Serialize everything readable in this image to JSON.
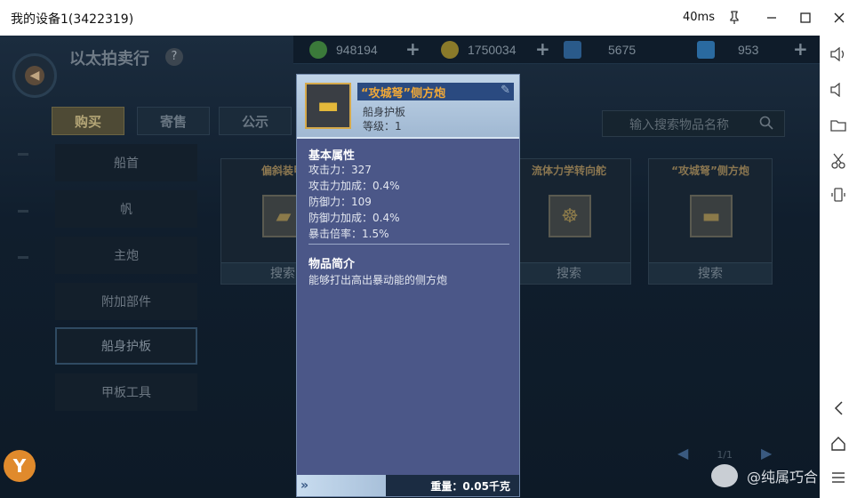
{
  "window": {
    "title": "我的设备1(3422319)",
    "latency": "40ms",
    "pin_icon": "pin-icon",
    "minimize_icon": "minimize-icon",
    "maximize_icon": "maximize-icon",
    "close_icon": "close-icon"
  },
  "sidebar": {
    "items": [
      {
        "name": "volume-up-icon",
        "glyph": "🔊"
      },
      {
        "name": "volume-down-icon",
        "glyph": "🔉"
      },
      {
        "name": "folder-icon",
        "glyph": "🗀"
      },
      {
        "name": "scissors-icon",
        "glyph": "✂"
      },
      {
        "name": "rotate-icon",
        "glyph": "⟲"
      },
      {
        "name": "back-icon",
        "glyph": "‹"
      },
      {
        "name": "home-icon",
        "glyph": "⌂"
      },
      {
        "name": "menu-icon",
        "glyph": "☰"
      }
    ]
  },
  "game": {
    "page_title": "以太拍卖行",
    "help_label": "?",
    "resources": [
      {
        "value": "948194",
        "color": "#3b7a3a"
      },
      {
        "value": "1750034",
        "color": "#8a7a2a"
      },
      {
        "value": "5675",
        "color": "#2a5a8a"
      },
      {
        "value": "953",
        "color": "#2a6aa0"
      }
    ],
    "plus": "+",
    "tabs": [
      "购买",
      "寄售",
      "公示"
    ],
    "search_placeholder": "输入搜索物品名称",
    "categories": [
      "船首",
      "帆",
      "主炮",
      "附加部件",
      "船身护板",
      "甲板工具"
    ],
    "active_category_index": 4,
    "cards": [
      {
        "title": "偏斜装甲",
        "button": "搜索"
      },
      {
        "title": "流体力学转向舵",
        "button": "搜索"
      },
      {
        "title": "“攻城弩”侧方炮",
        "button": "搜索"
      }
    ],
    "pager": "1/1"
  },
  "popup": {
    "item_name": "“攻城弩”侧方炮",
    "item_type": "船身护板",
    "item_level": "等级：1",
    "basic_attr_title": "基本属性",
    "attributes": [
      "攻击力：327",
      "攻击力加成：0.4%",
      "防御力：109",
      "防御力加成：0.4%",
      "暴击倍率：1.5%"
    ],
    "intro_title": "物品简介",
    "intro_text": "能够打出高出暴动能的侧方炮",
    "weight": "重量：0.05千克"
  },
  "watermark": "@纯属巧合"
}
